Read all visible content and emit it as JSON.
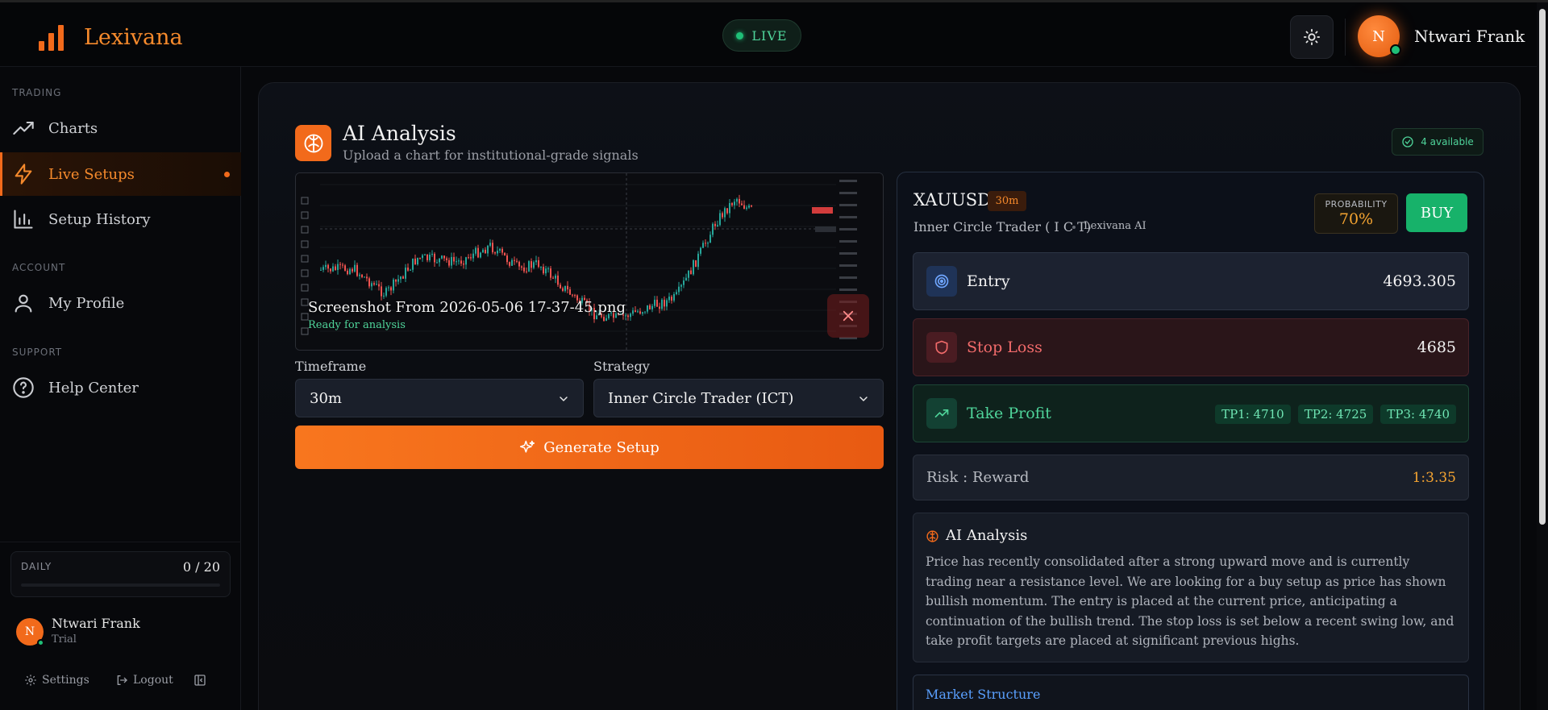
{
  "header": {
    "brand": "Lexivana",
    "live_label": "LIVE",
    "user_initial": "N",
    "user_name": "Ntwari Frank"
  },
  "sidebar": {
    "sections": {
      "trading": "TRADING",
      "account": "ACCOUNT",
      "support": "SUPPORT"
    },
    "items": [
      {
        "label": "Charts",
        "icon": "trending-up-icon"
      },
      {
        "label": "Live Setups",
        "icon": "lightning-icon",
        "active": true
      },
      {
        "label": "Setup History",
        "icon": "bar-chart-icon"
      },
      {
        "label": "My Profile",
        "icon": "user-icon"
      },
      {
        "label": "Help Center",
        "icon": "help-circle-icon"
      }
    ],
    "daily": {
      "label": "DAILY",
      "count": "0 / 20",
      "progress": 0
    },
    "user": {
      "initial": "N",
      "name": "Ntwari Frank",
      "plan": "Trial"
    },
    "footer": {
      "settings": "Settings",
      "logout": "Logout"
    }
  },
  "main": {
    "title": "AI Analysis",
    "subtitle": "Upload a chart for institutional-grade signals",
    "available": "4 available",
    "upload": {
      "file_name": "Screenshot From 2026-05-06 17-37-45.png",
      "status": "Ready for analysis"
    },
    "timeframe": {
      "label": "Timeframe",
      "value": "30m"
    },
    "strategy": {
      "label": "Strategy",
      "value": "Inner Circle Trader (ICT)"
    },
    "generate_label": "Generate Setup"
  },
  "result": {
    "symbol": "XAUUSD",
    "timeframe": "30m",
    "strategy": "Inner Circle Trader ( I C T)",
    "source": "Lexivana AI",
    "probability_label": "PROBABILITY",
    "probability": "70%",
    "direction": "BUY",
    "entry": {
      "label": "Entry",
      "value": "4693.305"
    },
    "stop_loss": {
      "label": "Stop Loss",
      "value": "4685"
    },
    "take_profit": {
      "label": "Take Profit",
      "targets": [
        "TP1: 4710",
        "TP2: 4725",
        "TP3: 4740"
      ]
    },
    "risk_reward": {
      "label": "Risk : Reward",
      "value": "1:3.35"
    },
    "analysis": {
      "title": "AI Analysis",
      "text": "Price has recently consolidated after a strong upward move and is currently trading near a resistance level. We are looking for a buy setup as price has shown bullish momentum. The entry is placed at the current price, anticipating a continuation of the bullish trend. The stop loss is set below a recent swing low, and take profit targets are placed at significant previous highs."
    },
    "market_structure": {
      "title": "Market Structure"
    }
  },
  "colors": {
    "accent": "#f26a1b",
    "buy": "#17b26a",
    "live": "#1fbf77",
    "stop": "#f26b6b",
    "profit": "#4fd49a",
    "probability": "#f5a431"
  }
}
